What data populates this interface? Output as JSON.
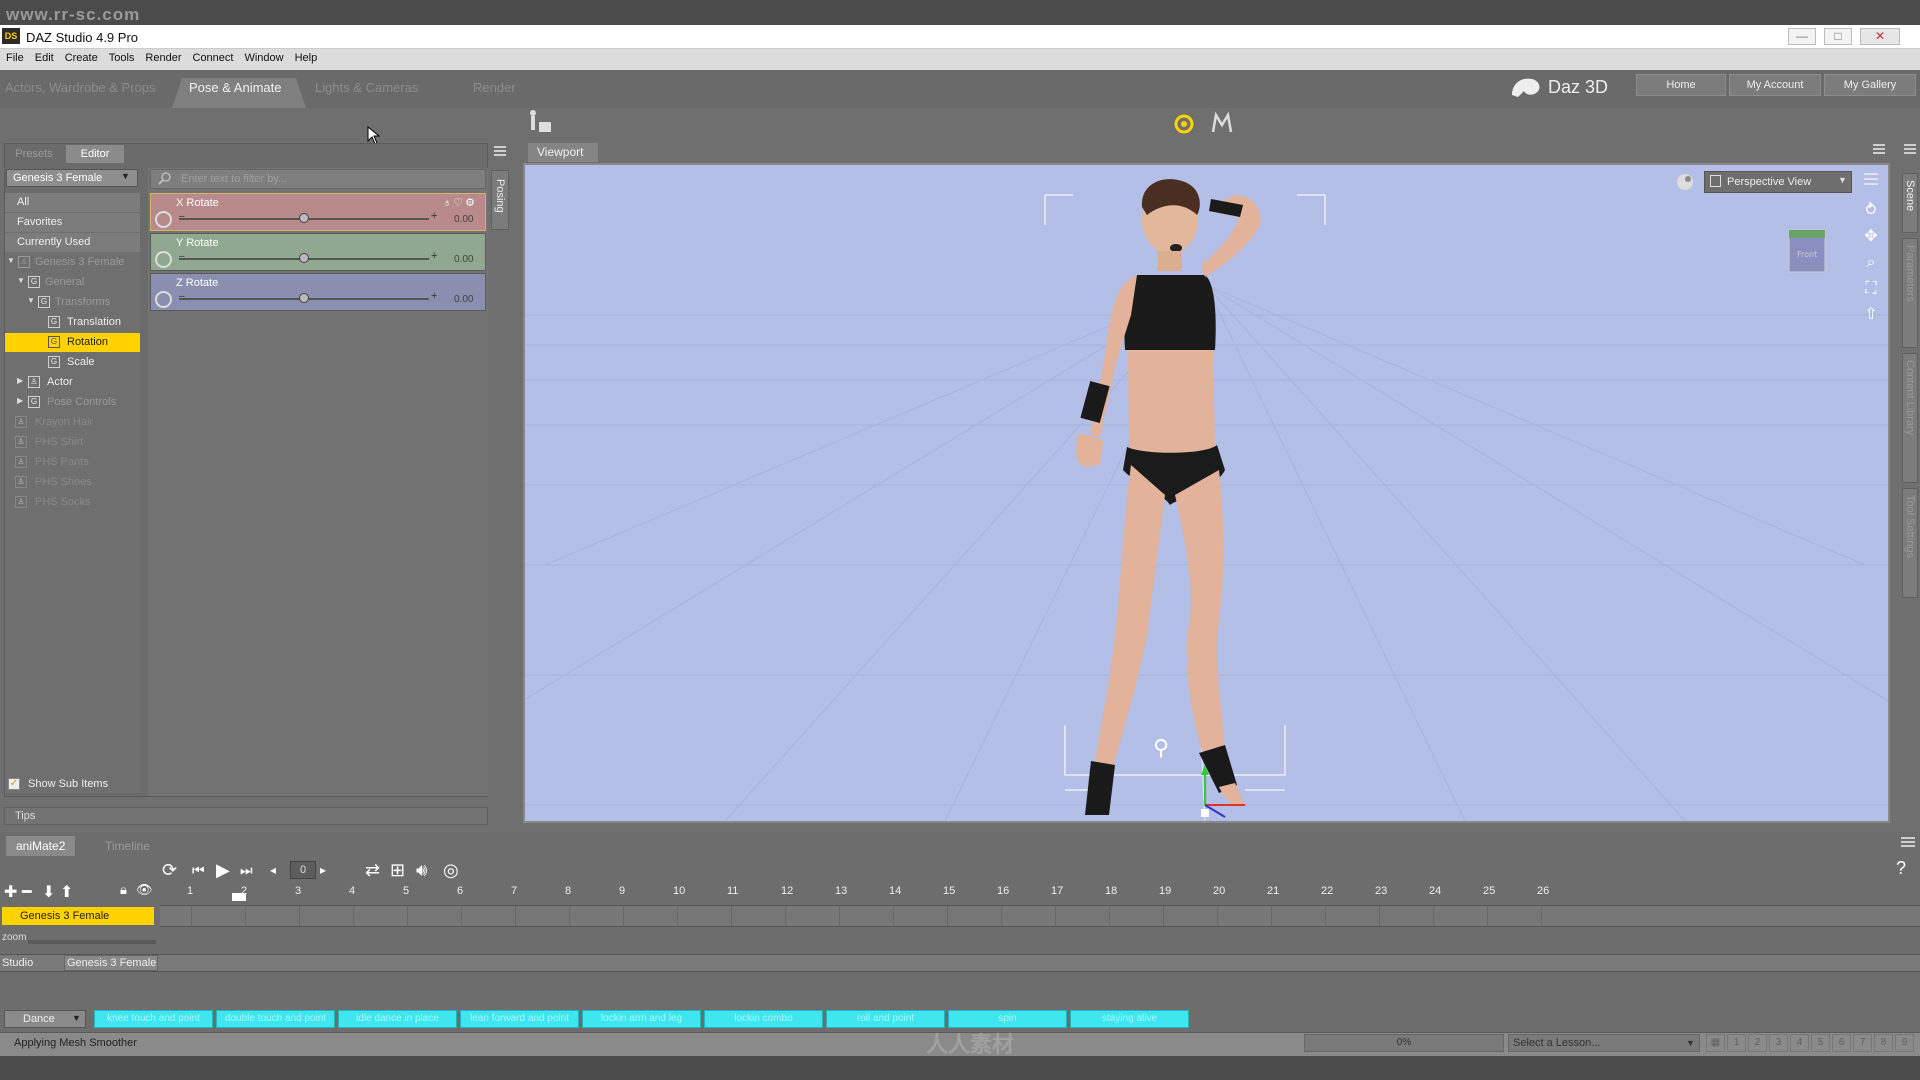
{
  "watermark": {
    "top": "www.rr-sc.com",
    "bottom": "人人素材"
  },
  "window": {
    "title": "DAZ Studio 4.9 Pro",
    "app_icon": "DS",
    "min": "—",
    "max": "□",
    "close": "✕"
  },
  "menu": [
    "File",
    "Edit",
    "Create",
    "Tools",
    "Render",
    "Connect",
    "Window",
    "Help"
  ],
  "main_tabs": [
    "Actors, Wardrobe & Props",
    "Pose & Animate",
    "Lights & Cameras",
    "Render"
  ],
  "brand": {
    "name": "Daz 3D",
    "links": [
      "Home",
      "My Account",
      "My Gallery"
    ]
  },
  "posing_pane": {
    "tabs": [
      "Presets",
      "Editor"
    ],
    "figure_select": "Genesis 3 Female",
    "filter_placeholder": "Enter text to filter by...",
    "tree": [
      "All",
      "Favorites",
      "Currently Used",
      "Genesis 3 Female",
      "General",
      "Transforms",
      "Translation",
      "Rotation",
      "Scale",
      "Actor",
      "Pose Controls",
      "Krayon Hair",
      "PHS Shirt",
      "PHS Pants",
      "PHS Shoes",
      "PHS Socks"
    ],
    "show_sub_items": "Show Sub Items",
    "sliders": [
      {
        "name": "X Rotate",
        "value": "0.00",
        "color": "#c98a8a"
      },
      {
        "name": "Y Rotate",
        "value": "0.00",
        "color": "#8fb08f"
      },
      {
        "name": "Z Rotate",
        "value": "0.00",
        "color": "#8a8fc0"
      }
    ],
    "side_tab": "Posing",
    "tips": "Tips"
  },
  "viewport": {
    "tab": "Viewport",
    "camera": "Perspective View"
  },
  "right_tabs": [
    "Scene",
    "Parameters",
    "Content Library",
    "Tool Settings"
  ],
  "animate": {
    "tabs": [
      "aniMate2",
      "Timeline"
    ],
    "frame": "0",
    "ruler": [
      "1",
      "2",
      "3",
      "4",
      "5",
      "6",
      "7",
      "8",
      "9",
      "10",
      "11",
      "12",
      "13",
      "14",
      "15",
      "16",
      "17",
      "18",
      "19",
      "20",
      "21",
      "22",
      "23",
      "24",
      "25",
      "26"
    ],
    "layer": "Genesis 3 Female",
    "zoom_label": "zoom",
    "studio_label": "Studio",
    "studio_figure": "Genesis 3 Female",
    "category": "Dance",
    "blocks": [
      "knee touch and point",
      "double touch and point",
      "idle dance in place",
      "lean forward and point",
      "lockin arm and leg",
      "lockin combo",
      "roll and point",
      "spin",
      "staying alive"
    ]
  },
  "status": {
    "text": "Applying Mesh Smoother",
    "progress": "0%",
    "progress_fraction": 0,
    "lesson": "Select a Lesson...",
    "pages": [
      "1",
      "2",
      "3",
      "4",
      "5",
      "6",
      "7",
      "8",
      "9"
    ]
  },
  "icons": {
    "lesson_arrow": "chevron-down-icon",
    "help": "?"
  },
  "colors": {
    "accent_yellow": "#ffd200",
    "viewport_bg": "#b3bfe6",
    "block_cyan": "#3fe5ef"
  }
}
